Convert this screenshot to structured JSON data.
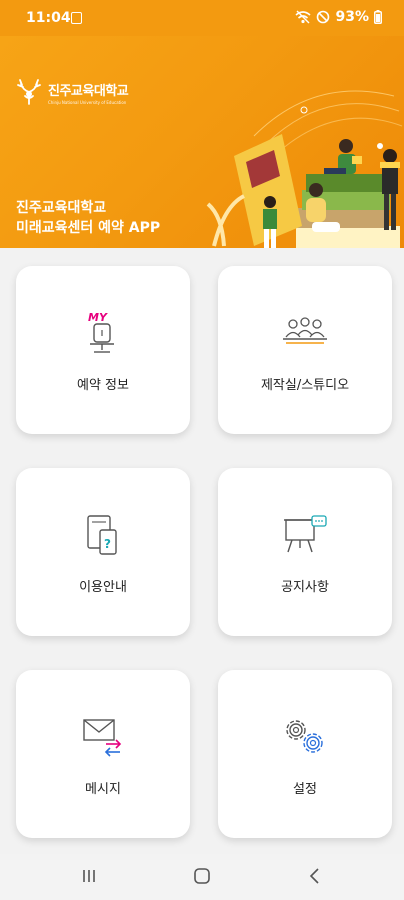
{
  "status_bar": {
    "time": "11:04",
    "battery": "93%"
  },
  "banner": {
    "logo_name": "진주교육대학교",
    "logo_sub": "Chinju National University of Education",
    "title_line1": "진주교육대학교",
    "title_line2": "미래교육센터 예약 APP"
  },
  "menu": [
    {
      "label": "예약 정보",
      "icon": "my-reservation-icon"
    },
    {
      "label": "제작실/스튜디오",
      "icon": "studio-people-icon"
    },
    {
      "label": "이용안내",
      "icon": "guide-tablet-icon"
    },
    {
      "label": "공지사항",
      "icon": "notice-board-icon"
    },
    {
      "label": "메시지",
      "icon": "message-envelope-icon"
    },
    {
      "label": "설정",
      "icon": "settings-gears-icon"
    }
  ],
  "colors": {
    "accent": "#f39a10",
    "pink": "#e6007e",
    "blue": "#2a6fdb",
    "teal": "#19a8b4"
  }
}
